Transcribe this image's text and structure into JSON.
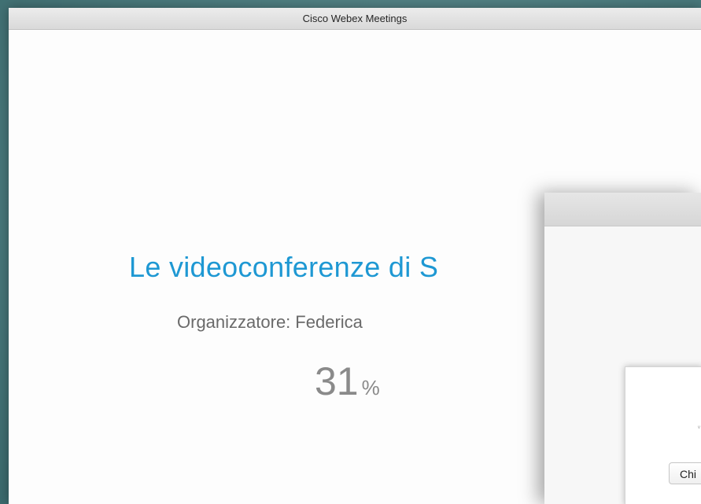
{
  "window": {
    "title": "Cisco Webex Meetings"
  },
  "meeting": {
    "title": "Le videoconferenze di S",
    "organizer_label": "Organizzatore:",
    "organizer_name": "Federica",
    "progress_value": "31",
    "progress_unit": "%"
  },
  "dialog": {
    "mark": "ᵛ",
    "button_label": "Chi"
  },
  "colors": {
    "title_blue": "#1e98d3",
    "desktop": "#4d7d80"
  }
}
